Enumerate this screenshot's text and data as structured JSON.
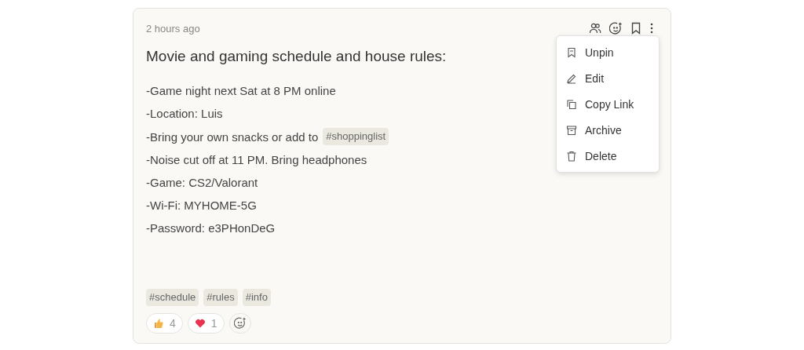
{
  "note": {
    "time": "2 hours ago",
    "title": "Movie and gaming schedule and house rules:",
    "lines": [
      {
        "text": "-Game night next Sat at 8 PM online"
      },
      {
        "text": "-Location: Luis"
      },
      {
        "text": "-Bring your own snacks or add to",
        "tag": "#shoppinglist"
      },
      {
        "text": "-Noise cut off at 11 PM. Bring headphones"
      },
      {
        "text": "-Game: CS2/Valorant"
      },
      {
        "text": "-Wi-Fi: MYHOME-5G"
      },
      {
        "text": "-Password: e3PHonDeG"
      }
    ],
    "tags": [
      "#schedule",
      "#rules",
      "#info"
    ],
    "reactions": [
      {
        "kind": "thumb",
        "count": "4"
      },
      {
        "kind": "heart",
        "count": "1"
      }
    ]
  },
  "menu": [
    {
      "kind": "unpin",
      "label": "Unpin"
    },
    {
      "kind": "edit",
      "label": "Edit"
    },
    {
      "kind": "copy",
      "label": "Copy Link"
    },
    {
      "kind": "archive",
      "label": "Archive"
    },
    {
      "kind": "delete",
      "label": "Delete"
    }
  ]
}
